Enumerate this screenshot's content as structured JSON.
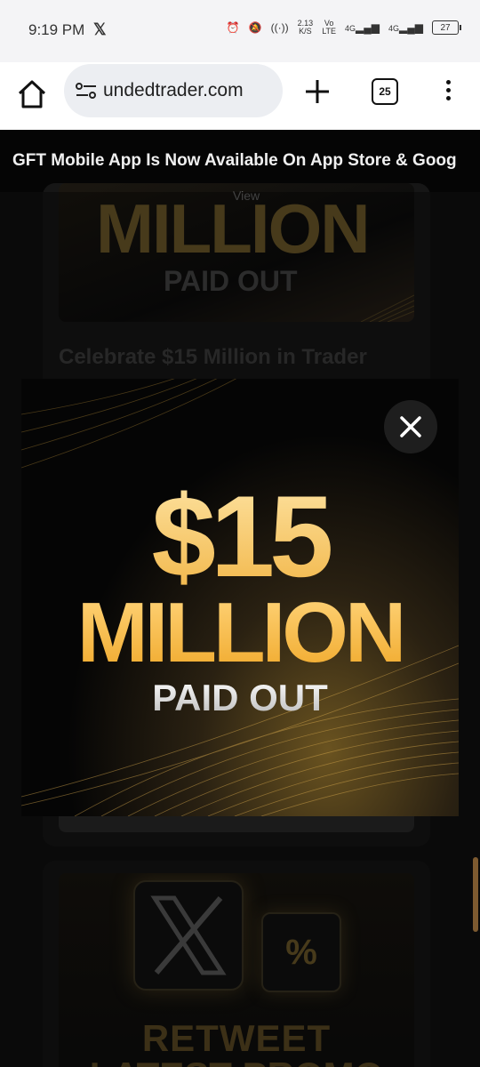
{
  "status_bar": {
    "time": "9:19 PM",
    "notification_icon": "x-logo-icon",
    "data_speed": "2.13",
    "data_speed_unit": "K/S",
    "volte": "Vo",
    "volte_sub": "LTE",
    "network1": "4G",
    "network2": "4G",
    "battery": "27"
  },
  "browser": {
    "url": "undedtrader.com",
    "tab_count": "25"
  },
  "banner": {
    "text": "GFT Mobile App Is Now Available On App Store & Goog"
  },
  "background_cards": {
    "card1_view": "View",
    "card1_million": "MILLION",
    "card1_paid": "PAID OUT",
    "card1_title": "Celebrate $15 Million in Trader",
    "card2_pct": "%",
    "card2_line1": "RETWEET",
    "card2_line2": "LATEST PROMO"
  },
  "modal": {
    "amount": "$15",
    "million": "MILLION",
    "paid_out": "PAID OUT",
    "close_icon": "close-icon"
  },
  "colors": {
    "accent_gold": "#f2b74a",
    "page_bg": "#101010"
  }
}
